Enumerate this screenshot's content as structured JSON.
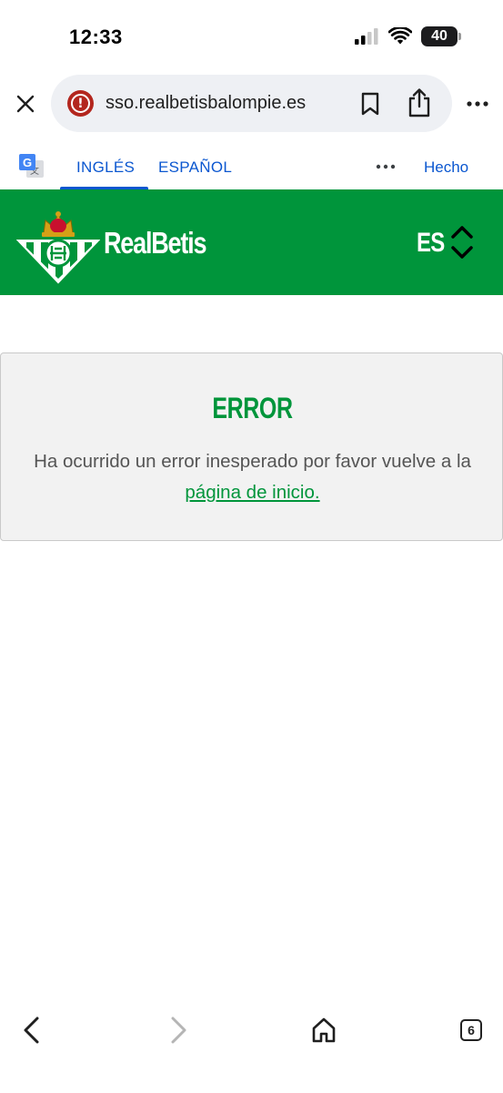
{
  "status_bar": {
    "time": "12:33",
    "battery_level": "40",
    "icons": [
      "cellular-signal-icon",
      "wifi-icon",
      "battery-icon"
    ]
  },
  "browser": {
    "url": "sso.realbetisbalompie.es",
    "security_state": "dangerous-site-icon",
    "toolbar_icons": [
      "close-icon",
      "bookmark-icon",
      "share-icon",
      "more-vertical-icon"
    ]
  },
  "translate_bar": {
    "source_tab": "INGLÉS",
    "target_tab": "ESPAÑOL",
    "done_label": "Hecho",
    "icon": "google-translate-icon",
    "accent_color": "#0b57d0"
  },
  "site": {
    "brand_name": "RealBetis",
    "language_code": "ES",
    "brand_color": "#00953b"
  },
  "error": {
    "title": "ERROR",
    "message_before_link": "Ha ocurrido un error inesperado por favor vuelve a la ",
    "link_text": "página de inicio."
  },
  "bottom_toolbar": {
    "icons": [
      "back-icon",
      "forward-icon",
      "home-icon",
      "tabs-icon"
    ],
    "tab_count": "6"
  }
}
